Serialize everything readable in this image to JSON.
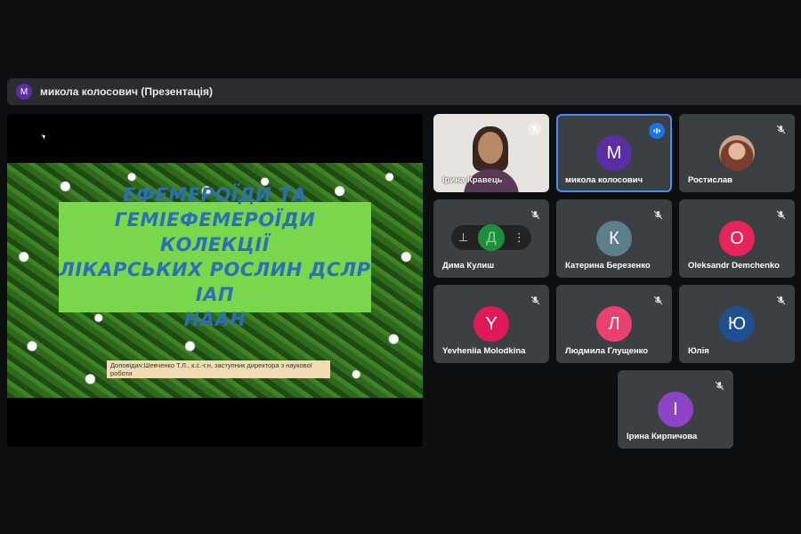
{
  "presentation_bar": {
    "avatar_letter": "М",
    "title": "микола колосович (Презентація)"
  },
  "slide": {
    "title": "ЕФЕМЕРОЇДИ ТА\nГЕМІЕФЕМЕРОЇДИ КОЛЕКЦІЇ\nЛІКАРСЬКИХ РОСЛИН ДСЛР ІАП\nНААН",
    "caption": "Доповідач:Шевченко Т.Л., к.с.-г.н, заступник директора з наукової роботи"
  },
  "hover_menu": {
    "pin_glyph": "⊥",
    "letter": "Д",
    "more_glyph": "⋮"
  },
  "participants": [
    {
      "name": "Ірина Кравець",
      "type": "video",
      "mic": "muted"
    },
    {
      "name": "микола колосович",
      "letter": "М",
      "color": "#5b2ea6",
      "mic": "speaking",
      "active": true
    },
    {
      "name": "Ростислав",
      "type": "photo",
      "mic": "muted"
    },
    {
      "name": "Дима Кулиш",
      "letter": "Д",
      "mic": "muted",
      "hovered": true
    },
    {
      "name": "Катерина Березенко",
      "letter": "К",
      "color": "#5c7f8a",
      "mic": "muted"
    },
    {
      "name": "Oleksandr Demchenko",
      "letter": "O",
      "color": "#e8245c",
      "mic": "muted"
    },
    {
      "name": "Yevheniia Molodkina",
      "letter": "Y",
      "color": "#e0195a",
      "mic": "muted"
    },
    {
      "name": "Людмила Глущенко",
      "letter": "Л",
      "color": "#ec4070",
      "mic": "muted"
    },
    {
      "name": "Юлія",
      "letter": "Ю",
      "color": "#1d4f91",
      "mic": "muted"
    },
    {
      "name": "Ірина Кирпичова",
      "letter": "І",
      "color": "#8e44c6",
      "mic": "muted"
    }
  ],
  "colors": {
    "accent": "#1a73e8",
    "tile_bg": "#3c4043",
    "slide_box": "#7ad64a",
    "slide_text": "#2b6fb8"
  }
}
